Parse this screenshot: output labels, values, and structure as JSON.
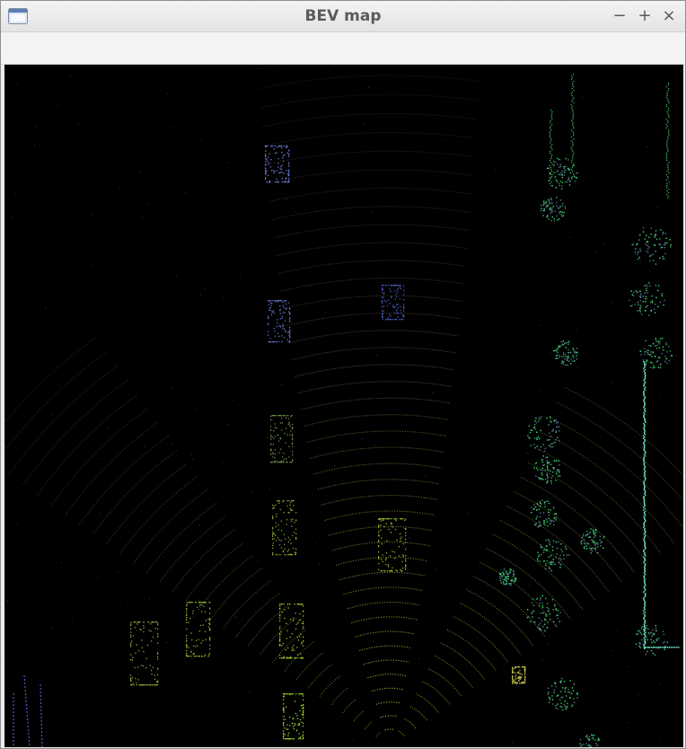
{
  "window": {
    "title": "BEV map",
    "buttons": {
      "minimize": "−",
      "maximize": "+",
      "close": "×"
    },
    "icon": "window-app-icon"
  },
  "bev_map": {
    "background_color": "#000000",
    "description_colors": {
      "near_points": "#8fc230",
      "mid_points": "#5a8a3a",
      "far_points": "#5b3a6a",
      "vegetation": "#39d36a",
      "curb_right": "#6fe0c8",
      "blue_points": "#5b6fd8"
    }
  }
}
